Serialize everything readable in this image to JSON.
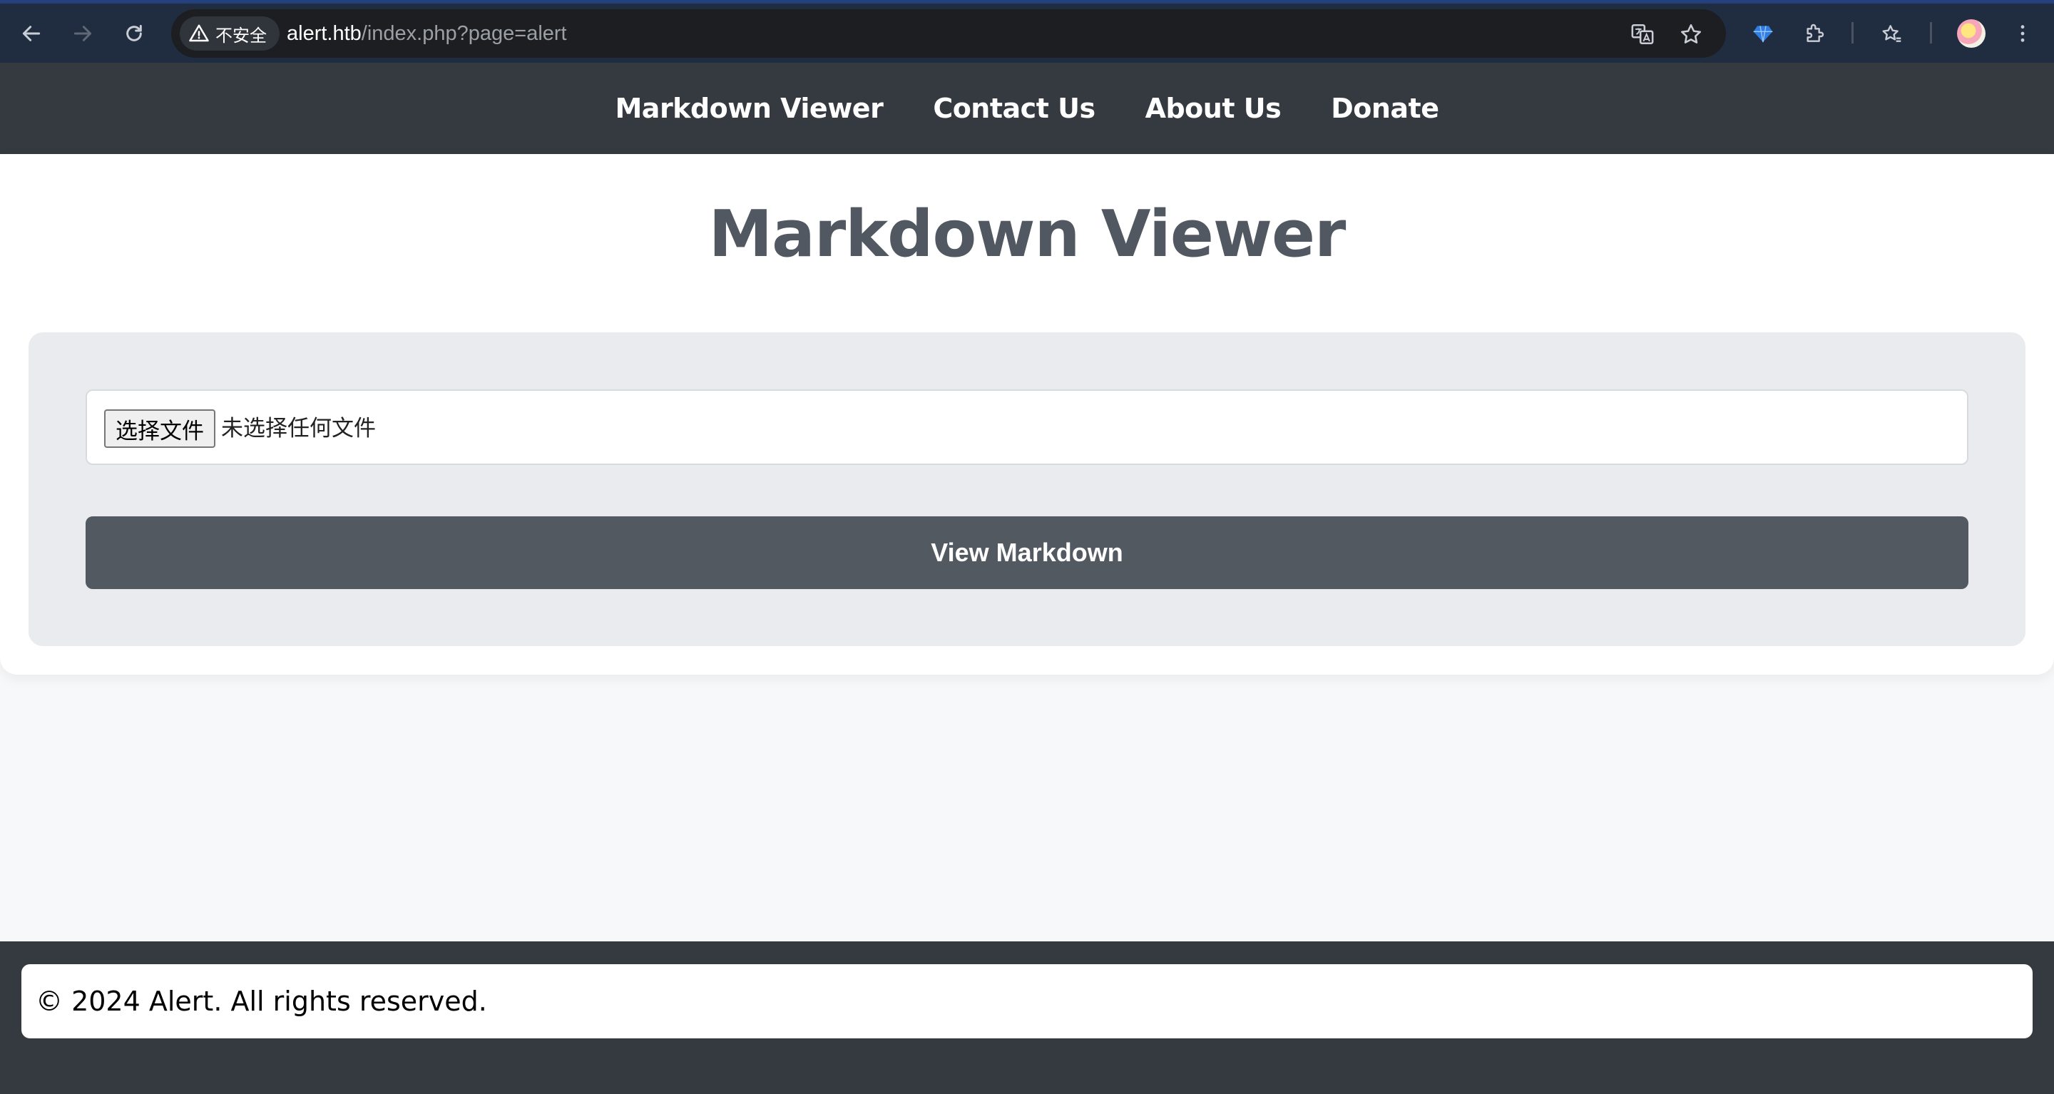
{
  "browser": {
    "security_label": "不安全",
    "url_host": "alert.htb",
    "url_path": "/index.php?page=alert",
    "icons": [
      "back-arrow-icon",
      "forward-arrow-icon",
      "reload-icon",
      "warning-icon",
      "translate-icon",
      "bookmark-star-icon",
      "gem-extension-icon",
      "puzzle-extensions-icon",
      "reading-list-icon",
      "avatar",
      "more-vert-icon"
    ]
  },
  "nav": {
    "items": [
      {
        "label": "Markdown Viewer"
      },
      {
        "label": "Contact Us"
      },
      {
        "label": "About Us"
      },
      {
        "label": "Donate"
      }
    ]
  },
  "main": {
    "title": "Markdown Viewer",
    "file_input": {
      "button_label": "选择文件",
      "status": "未选择任何文件"
    },
    "submit_label": "View Markdown"
  },
  "footer": {
    "text": "© 2024 Alert. All rights reserved."
  },
  "colors": {
    "nav_bg": "#353a40",
    "title": "#515861",
    "button_bg": "#535961",
    "panel_bg": "#e9ebee",
    "page_bg": "#f7f8fa"
  }
}
